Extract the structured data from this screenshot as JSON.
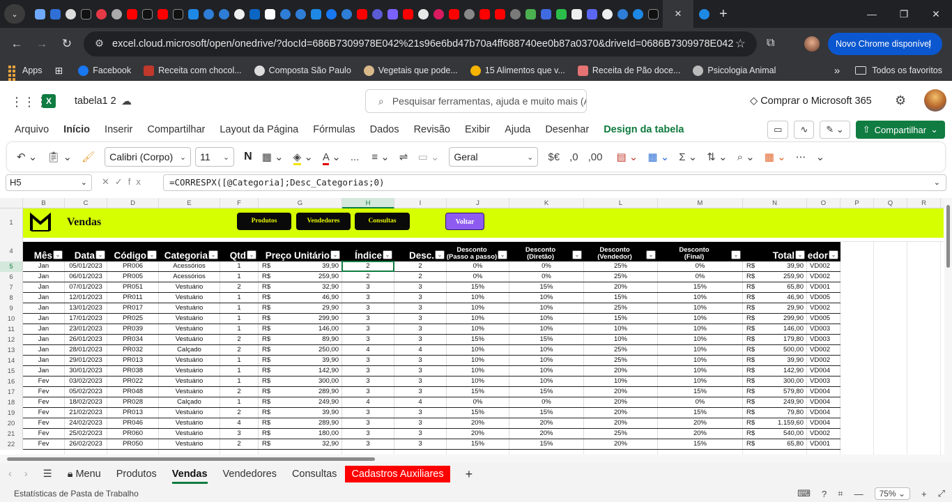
{
  "browser": {
    "active_tab_close": "✕",
    "new_tab": "+",
    "url": "excel.cloud.microsoft/open/onedrive/?docId=686B7309978E042%21s96e6bd47b70a4ff688740ee0b87a0370&driveId=0686B7309978E042",
    "update_button": "Novo Chrome disponível",
    "bookmarks": [
      "Apps",
      "Facebook",
      "Receita com chocol...",
      "Composta São Paulo",
      "Vegetais que pode...",
      "15 Alimentos que v...",
      "Receita de Pão doce...",
      "Psicologia Animal"
    ],
    "bookmarks_more": "»",
    "all_bookmarks": "Todos os favoritos"
  },
  "excel": {
    "doc_title": "tabela1 2",
    "search_placeholder": "Pesquisar ferramentas, ajuda e muito mais (Alt + Q)",
    "buy": "Comprar o Microsoft 365",
    "menu": [
      "Arquivo",
      "Início",
      "Inserir",
      "Compartilhar",
      "Layout da Página",
      "Fórmulas",
      "Dados",
      "Revisão",
      "Exibir",
      "Ajuda",
      "Desenhar",
      "Design da tabela"
    ],
    "share_label": "Compartilhar",
    "ribbon": {
      "font": "Calibri (Corpo)",
      "size": "11",
      "bold": "N",
      "number_format": "Geral",
      "currency": "$€",
      "more": "..."
    },
    "name_box": "H5",
    "formula": "=CORRESPX([@Categoria];Desc_Categorias;0)",
    "columns": [
      {
        "id": "B",
        "w": 60
      },
      {
        "id": "C",
        "w": 61
      },
      {
        "id": "D",
        "w": 74
      },
      {
        "id": "E",
        "w": 88
      },
      {
        "id": "F",
        "w": 55
      },
      {
        "id": "G",
        "w": 120
      },
      {
        "id": "H",
        "w": 75
      },
      {
        "id": "I",
        "w": 75
      },
      {
        "id": "J",
        "w": 90
      },
      {
        "id": "K",
        "w": 107
      },
      {
        "id": "L",
        "w": 106
      },
      {
        "id": "M",
        "w": 122
      },
      {
        "id": "N",
        "w": 92
      },
      {
        "id": "O",
        "w": 48
      },
      {
        "id": "P",
        "w": 48
      },
      {
        "id": "Q",
        "w": 48
      },
      {
        "id": "R",
        "w": 48
      }
    ],
    "row_numbers": {
      "banner": "1",
      "header": "4"
    },
    "banner": {
      "title": "Vendas",
      "buttons": [
        "Produtos",
        "Vendedores",
        "Consultas"
      ],
      "back": "Voltar"
    },
    "headers": [
      {
        "t": "Mês",
        "s": false
      },
      {
        "t": "Data",
        "s": false
      },
      {
        "t": "Código",
        "s": false
      },
      {
        "t": "Categoria",
        "s": false
      },
      {
        "t": "Qtd",
        "s": false
      },
      {
        "t": "Preço Unitário",
        "s": false
      },
      {
        "t": "Índice",
        "s": false
      },
      {
        "t": "Desc.",
        "s": false
      },
      {
        "t": "Desconto (Passo a passo)",
        "s": true
      },
      {
        "t": "Desconto (Diretão)",
        "s": true
      },
      {
        "t": "Desconto (Vendedor)",
        "s": true
      },
      {
        "t": "Desconto (Final)",
        "s": true
      },
      {
        "t": "Total",
        "s": false
      },
      {
        "t": "Vendedor",
        "s": false
      }
    ],
    "filter_glyph": "⌄",
    "rows": [
      [
        "5",
        "Jan",
        "05/01/2023",
        "PR006",
        "Acessórios",
        "1",
        "39,90",
        "2",
        "2",
        "0%",
        "0%",
        "25%",
        "0%",
        "39,90",
        "VD002"
      ],
      [
        "6",
        "Jan",
        "06/01/2023",
        "PR005",
        "Acessórios",
        "1",
        "259,90",
        "2",
        "2",
        "0%",
        "0%",
        "25%",
        "0%",
        "259,90",
        "VD002"
      ],
      [
        "7",
        "Jan",
        "07/01/2023",
        "PR051",
        "Vestuário",
        "2",
        "32,90",
        "3",
        "3",
        "15%",
        "15%",
        "20%",
        "15%",
        "65,80",
        "VD001"
      ],
      [
        "8",
        "Jan",
        "12/01/2023",
        "PR011",
        "Vestuário",
        "1",
        "46,90",
        "3",
        "3",
        "10%",
        "10%",
        "15%",
        "10%",
        "46,90",
        "VD005"
      ],
      [
        "9",
        "Jan",
        "13/01/2023",
        "PR017",
        "Vestuário",
        "1",
        "29,90",
        "3",
        "3",
        "10%",
        "10%",
        "25%",
        "10%",
        "29,90",
        "VD002"
      ],
      [
        "10",
        "Jan",
        "17/01/2023",
        "PR025",
        "Vestuário",
        "1",
        "299,90",
        "3",
        "3",
        "10%",
        "10%",
        "15%",
        "10%",
        "299,90",
        "VD005"
      ],
      [
        "11",
        "Jan",
        "23/01/2023",
        "PR039",
        "Vestuário",
        "1",
        "146,00",
        "3",
        "3",
        "10%",
        "10%",
        "10%",
        "10%",
        "146,00",
        "VD003"
      ],
      [
        "12",
        "Jan",
        "26/01/2023",
        "PR034",
        "Vestuário",
        "2",
        "89,90",
        "3",
        "3",
        "15%",
        "15%",
        "10%",
        "10%",
        "179,80",
        "VD003"
      ],
      [
        "13",
        "Jan",
        "28/01/2023",
        "PR032",
        "Calçado",
        "2",
        "250,00",
        "4",
        "4",
        "10%",
        "10%",
        "25%",
        "10%",
        "500,00",
        "VD002"
      ],
      [
        "14",
        "Jan",
        "29/01/2023",
        "PR013",
        "Vestuário",
        "1",
        "39,90",
        "3",
        "3",
        "10%",
        "10%",
        "25%",
        "10%",
        "39,90",
        "VD002"
      ],
      [
        "15",
        "Jan",
        "30/01/2023",
        "PR038",
        "Vestuário",
        "1",
        "142,90",
        "3",
        "3",
        "10%",
        "10%",
        "20%",
        "10%",
        "142,90",
        "VD004"
      ],
      [
        "16",
        "Fev",
        "03/02/2023",
        "PR022",
        "Vestuário",
        "1",
        "300,00",
        "3",
        "3",
        "10%",
        "10%",
        "10%",
        "10%",
        "300,00",
        "VD003"
      ],
      [
        "17",
        "Fev",
        "05/02/2023",
        "PR048",
        "Vestuário",
        "2",
        "289,90",
        "3",
        "3",
        "15%",
        "15%",
        "20%",
        "15%",
        "579,80",
        "VD004"
      ],
      [
        "18",
        "Fev",
        "18/02/2023",
        "PR028",
        "Calçado",
        "1",
        "249,90",
        "4",
        "4",
        "0%",
        "0%",
        "20%",
        "0%",
        "249,90",
        "VD004"
      ],
      [
        "19",
        "Fev",
        "21/02/2023",
        "PR013",
        "Vestuário",
        "2",
        "39,90",
        "3",
        "3",
        "15%",
        "15%",
        "20%",
        "15%",
        "79,80",
        "VD004"
      ],
      [
        "20",
        "Fev",
        "24/02/2023",
        "PR046",
        "Vestuário",
        "4",
        "289,90",
        "3",
        "3",
        "20%",
        "20%",
        "20%",
        "20%",
        "1.159,60",
        "VD004"
      ],
      [
        "21",
        "Fev",
        "25/02/2023",
        "PR060",
        "Vestuário",
        "3",
        "180,00",
        "3",
        "3",
        "20%",
        "20%",
        "25%",
        "20%",
        "540,00",
        "VD002"
      ],
      [
        "22",
        "Fev",
        "26/02/2023",
        "PR050",
        "Vestuário",
        "2",
        "32,90",
        "3",
        "3",
        "15%",
        "15%",
        "20%",
        "15%",
        "65,80",
        "VD001"
      ]
    ],
    "currency_symbol": "R$",
    "sheets": [
      "Menu",
      "Produtos",
      "Vendas",
      "Vendedores",
      "Consultas",
      "Cadastros Auxiliares"
    ],
    "active_sheet": "Vendas",
    "add_sheet": "+",
    "status_left": "Estatísticas de Pasta de Trabalho",
    "zoom": "75%",
    "zoom_minus": "—",
    "zoom_plus": "+"
  }
}
